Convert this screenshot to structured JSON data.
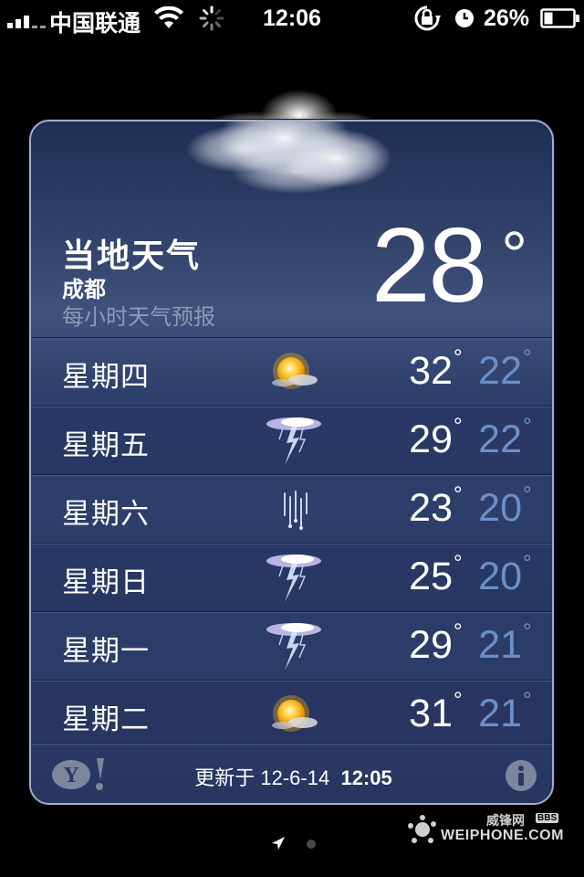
{
  "status_bar": {
    "carrier": "中国联通",
    "time": "12:06",
    "battery": "26%"
  },
  "weather": {
    "title": "当地天气",
    "city": "成都",
    "subtitle": "每小时天气预报",
    "current_temp": "28",
    "degree": "°"
  },
  "forecast": [
    {
      "day": "星期四",
      "icon": "sunny-partly-cloudy",
      "high": "32",
      "low": "22"
    },
    {
      "day": "星期五",
      "icon": "thunderstorm",
      "high": "29",
      "low": "22"
    },
    {
      "day": "星期六",
      "icon": "rain",
      "high": "23",
      "low": "20"
    },
    {
      "day": "星期日",
      "icon": "thunderstorm",
      "high": "25",
      "low": "20"
    },
    {
      "day": "星期一",
      "icon": "thunderstorm",
      "high": "29",
      "low": "21"
    },
    {
      "day": "星期二",
      "icon": "sunny-partly-cloudy",
      "high": "31",
      "low": "21"
    }
  ],
  "footer": {
    "updated_prefix": "更新于 12-6-14",
    "updated_time": "12:05"
  },
  "watermark": {
    "brand_cn": "威锋网",
    "bbs": "BBS",
    "brand_en": "WEIPHONE.COM"
  },
  "colors": {
    "panel_border": "#a4aec9",
    "low_temp": "#6b8fc9",
    "subtitle": "#8c98b7"
  }
}
